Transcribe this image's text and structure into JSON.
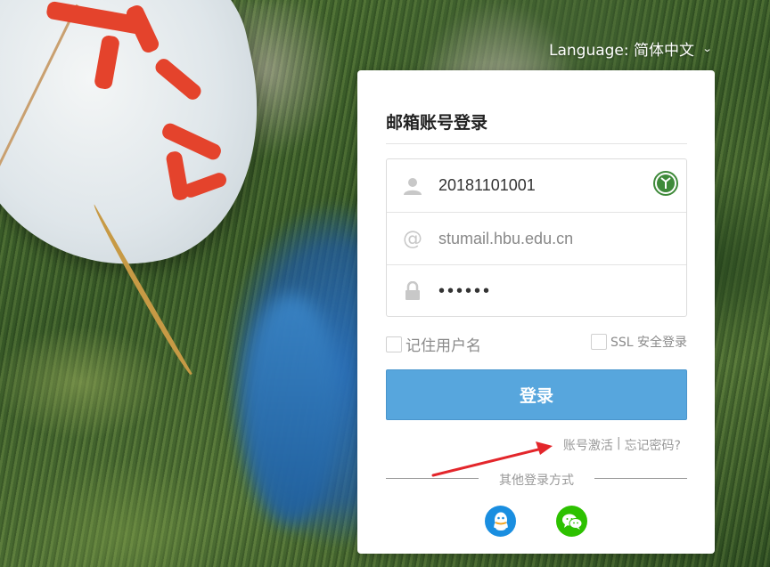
{
  "language": {
    "label": "Language: 简体中文",
    "chevron_icon": "chevron-down-icon"
  },
  "login": {
    "title": "邮箱账号登录",
    "username": {
      "value": "20181101001",
      "icon": "user-icon"
    },
    "domain": {
      "value": "stumail.hbu.edu.cn",
      "icon": "at-icon"
    },
    "password": {
      "value": "••••••",
      "icon": "lock-icon"
    },
    "remember_label": "记住用户名",
    "ssl_label": "SSL 安全登录",
    "submit_label": "登录",
    "activate_link": "账号激活",
    "separator": "|",
    "forgot_link": "忘记密码?",
    "other_methods_label": "其他登录方式",
    "social": [
      {
        "name": "qq-icon",
        "color": "#1a8ee0"
      },
      {
        "name": "wechat-icon",
        "color": "#2dc100"
      }
    ]
  },
  "colors": {
    "button": "#57a6dd",
    "annotation_arrow": "#e3262b"
  }
}
